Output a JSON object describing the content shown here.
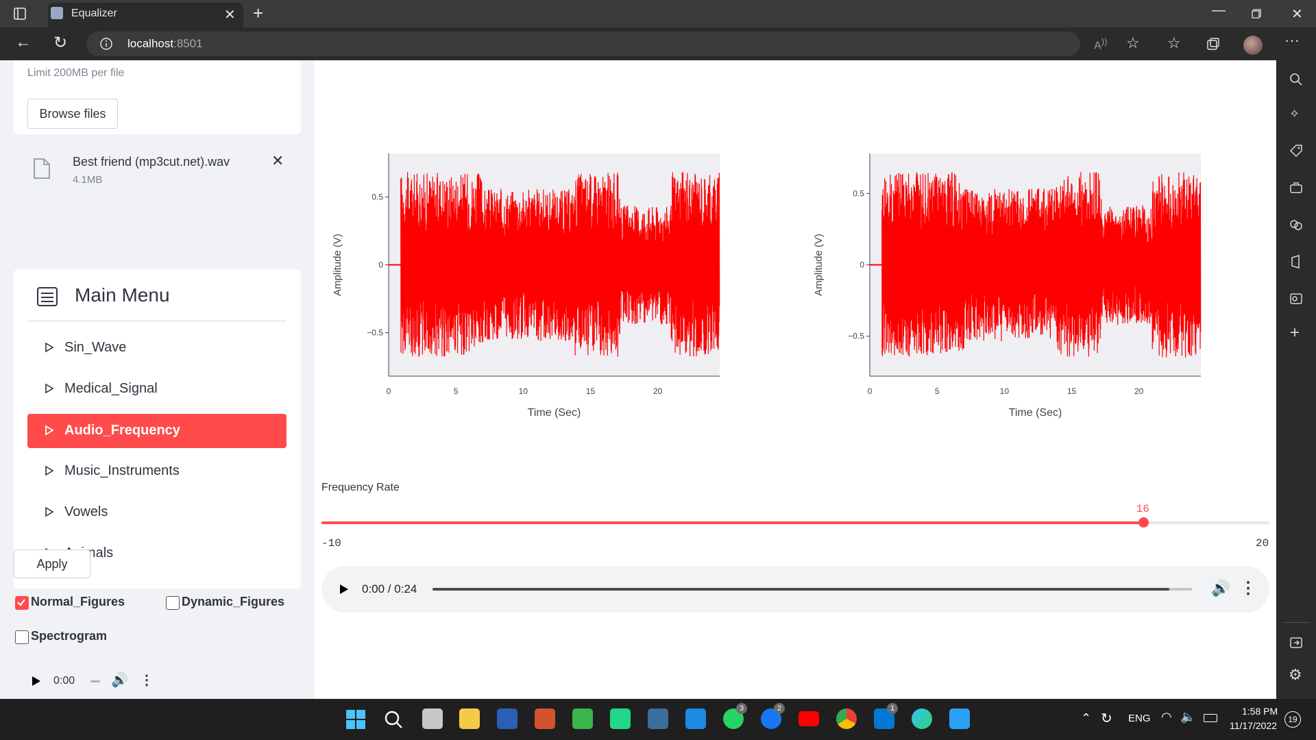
{
  "browser": {
    "tab_title": "Equalizer",
    "url_host": "localhost",
    "url_port": ":8501"
  },
  "sidebar": {
    "upload_limit": "Limit 200MB per file",
    "browse_label": "Browse files",
    "file_name": "Best friend (mp3cut.net).wav",
    "file_size": "4.1MB",
    "menu_title": "Main Menu",
    "menu_items": [
      {
        "label": "Sin_Wave"
      },
      {
        "label": "Medical_Signal"
      },
      {
        "label": "Audio_Frequency"
      },
      {
        "label": "Music_Instruments"
      },
      {
        "label": "Vowels"
      },
      {
        "label": "Animals"
      }
    ],
    "apply_label": "Apply",
    "checkboxes": [
      {
        "label": "Normal_Figures",
        "checked": true
      },
      {
        "label": "Dynamic_Figures",
        "checked": false
      },
      {
        "label": "Spectrogram",
        "checked": false
      }
    ],
    "mini_player_time": "0:00"
  },
  "main": {
    "slider": {
      "label": "Frequency Rate",
      "min_label": "-10",
      "max_label": "20",
      "value_label": "16",
      "value": 16,
      "min": -10,
      "max": 20
    },
    "player": {
      "time": "0:00 / 0:24",
      "progress": 0.97
    }
  },
  "chart_data": [
    {
      "type": "line",
      "series": [
        {
          "color": "#ff0000",
          "description": "audio waveform"
        }
      ],
      "xlabel": "Time (Sec)",
      "ylabel": "Amplitude (V)",
      "xlim": [
        0,
        24.6
      ],
      "ylim": [
        -0.82,
        0.82
      ],
      "x_ticks": [
        "0",
        "5",
        "10",
        "15",
        "20"
      ],
      "y_ticks": [
        "0.5",
        "0",
        "−0.5"
      ]
    },
    {
      "type": "line",
      "series": [
        {
          "color": "#ff0000",
          "description": "audio waveform"
        }
      ],
      "xlabel": "Time (Sec)",
      "ylabel": "Amplitude (V)",
      "xlim": [
        0,
        24.6
      ],
      "ylim": [
        -0.78,
        0.78
      ],
      "x_ticks": [
        "0",
        "5",
        "10",
        "15",
        "20"
      ],
      "y_ticks": [
        "0.5",
        "0",
        "−0.5"
      ]
    }
  ],
  "taskbar": {
    "lang": "ENG",
    "time": "1:58 PM",
    "date": "11/17/2022",
    "notif_count": "19",
    "badges": [
      "3",
      "2",
      "1"
    ]
  }
}
